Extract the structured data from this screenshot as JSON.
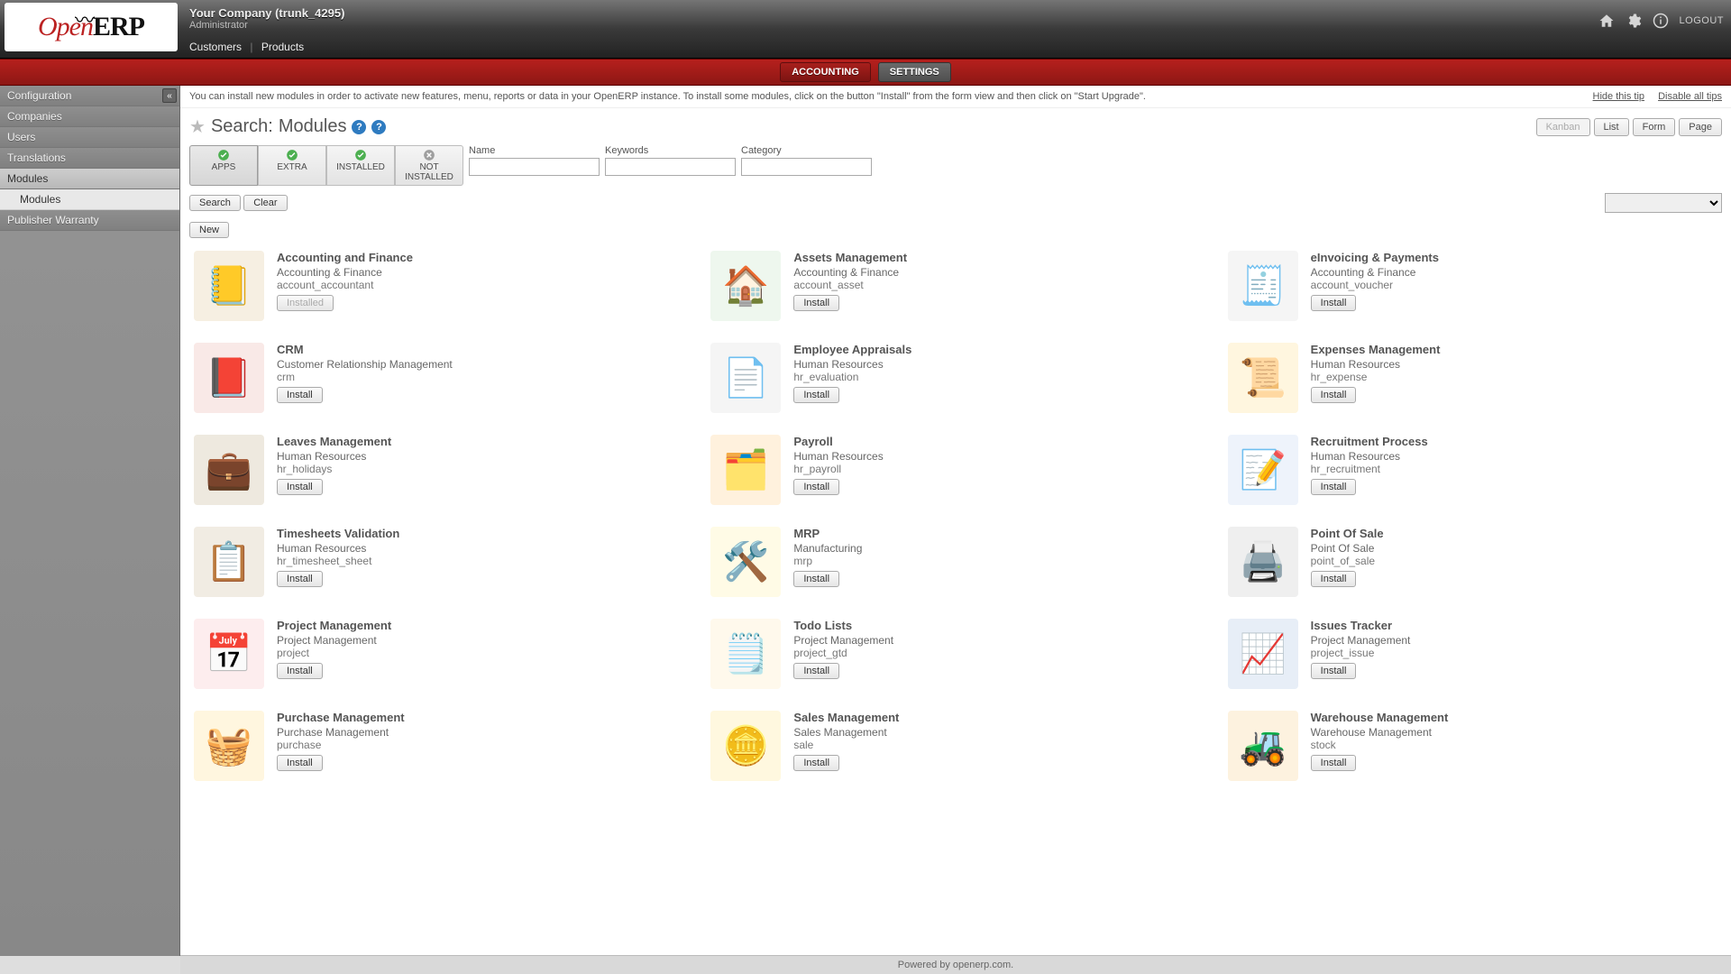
{
  "header": {
    "company": "Your Company (trunk_4295)",
    "role": "Administrator",
    "menus": [
      "Customers",
      "Products"
    ],
    "logout": "LOGOUT"
  },
  "main_tabs": [
    {
      "label": "ACCOUNTING",
      "active": false
    },
    {
      "label": "SETTINGS",
      "active": true
    }
  ],
  "sidebar": {
    "collapse_glyph": "«",
    "items": [
      {
        "label": "Configuration",
        "active": false
      },
      {
        "label": "Companies",
        "active": false
      },
      {
        "label": "Users",
        "active": false
      },
      {
        "label": "Translations",
        "active": false
      },
      {
        "label": "Modules",
        "active": true,
        "children": [
          {
            "label": "Modules"
          }
        ]
      },
      {
        "label": "Publisher Warranty",
        "active": false
      }
    ]
  },
  "tip": {
    "text": "You can install new modules in order to activate new features, menu, reports or data in your OpenERP instance. To install some modules, click on the button \"Install\" from the form view and then click on \"Start Upgrade\".",
    "hide": "Hide this tip",
    "disable": "Disable all tips"
  },
  "page": {
    "title_prefix": "Search:",
    "title": "Modules"
  },
  "view_buttons": [
    "Kanban",
    "List",
    "Form",
    "Page"
  ],
  "filters": [
    {
      "label": "APPS",
      "state": "green",
      "active": true
    },
    {
      "label": "EXTRA",
      "state": "green",
      "active": false
    },
    {
      "label": "INSTALLED",
      "state": "green",
      "active": false
    },
    {
      "label": "NOT INSTALLED",
      "state": "grey",
      "active": false
    }
  ],
  "fields": {
    "name": "Name",
    "keywords": "Keywords",
    "category": "Category"
  },
  "buttons": {
    "search": "Search",
    "clear": "Clear",
    "new": "New",
    "install": "Install",
    "installed": "Installed"
  },
  "modules": [
    {
      "title": "Accounting and Finance",
      "cat": "Accounting & Finance",
      "tech": "account_accountant",
      "installed": true,
      "icon": "📒",
      "bg": "#f6efe2"
    },
    {
      "title": "Assets Management",
      "cat": "Accounting & Finance",
      "tech": "account_asset",
      "installed": false,
      "icon": "🏠",
      "bg": "#eef7ee"
    },
    {
      "title": "eInvoicing & Payments",
      "cat": "Accounting & Finance",
      "tech": "account_voucher",
      "installed": false,
      "icon": "🧾",
      "bg": "#f5f5f5"
    },
    {
      "title": "CRM",
      "cat": "Customer Relationship Management",
      "tech": "crm",
      "installed": false,
      "icon": "📕",
      "bg": "#f9e9e7"
    },
    {
      "title": "Employee Appraisals",
      "cat": "Human Resources",
      "tech": "hr_evaluation",
      "installed": false,
      "icon": "📄",
      "bg": "#f5f5f5"
    },
    {
      "title": "Expenses Management",
      "cat": "Human Resources",
      "tech": "hr_expense",
      "installed": false,
      "icon": "📜",
      "bg": "#fff6df"
    },
    {
      "title": "Leaves Management",
      "cat": "Human Resources",
      "tech": "hr_holidays",
      "installed": false,
      "icon": "💼",
      "bg": "#eee9df"
    },
    {
      "title": "Payroll",
      "cat": "Human Resources",
      "tech": "hr_payroll",
      "installed": false,
      "icon": "🗂️",
      "bg": "#fff1dd"
    },
    {
      "title": "Recruitment Process",
      "cat": "Human Resources",
      "tech": "hr_recruitment",
      "installed": false,
      "icon": "📝",
      "bg": "#eef3fb"
    },
    {
      "title": "Timesheets Validation",
      "cat": "Human Resources",
      "tech": "hr_timesheet_sheet",
      "installed": false,
      "icon": "📋",
      "bg": "#f1ece3"
    },
    {
      "title": "MRP",
      "cat": "Manufacturing",
      "tech": "mrp",
      "installed": false,
      "icon": "🛠️",
      "bg": "#fffbe6"
    },
    {
      "title": "Point Of Sale",
      "cat": "Point Of Sale",
      "tech": "point_of_sale",
      "installed": false,
      "icon": "🖨️",
      "bg": "#efefef"
    },
    {
      "title": "Project Management",
      "cat": "Project Management",
      "tech": "project",
      "installed": false,
      "icon": "📅",
      "bg": "#fdedee"
    },
    {
      "title": "Todo Lists",
      "cat": "Project Management",
      "tech": "project_gtd",
      "installed": false,
      "icon": "🗒️",
      "bg": "#fff9ec"
    },
    {
      "title": "Issues Tracker",
      "cat": "Project Management",
      "tech": "project_issue",
      "installed": false,
      "icon": "📈",
      "bg": "#e7eef7"
    },
    {
      "title": "Purchase Management",
      "cat": "Purchase Management",
      "tech": "purchase",
      "installed": false,
      "icon": "🧺",
      "bg": "#fff6df"
    },
    {
      "title": "Sales Management",
      "cat": "Sales Management",
      "tech": "sale",
      "installed": false,
      "icon": "🪙",
      "bg": "#fff8df"
    },
    {
      "title": "Warehouse Management",
      "cat": "Warehouse Management",
      "tech": "stock",
      "installed": false,
      "icon": "🚜",
      "bg": "#fdf2df"
    }
  ],
  "footer": "Powered by openerp.com."
}
